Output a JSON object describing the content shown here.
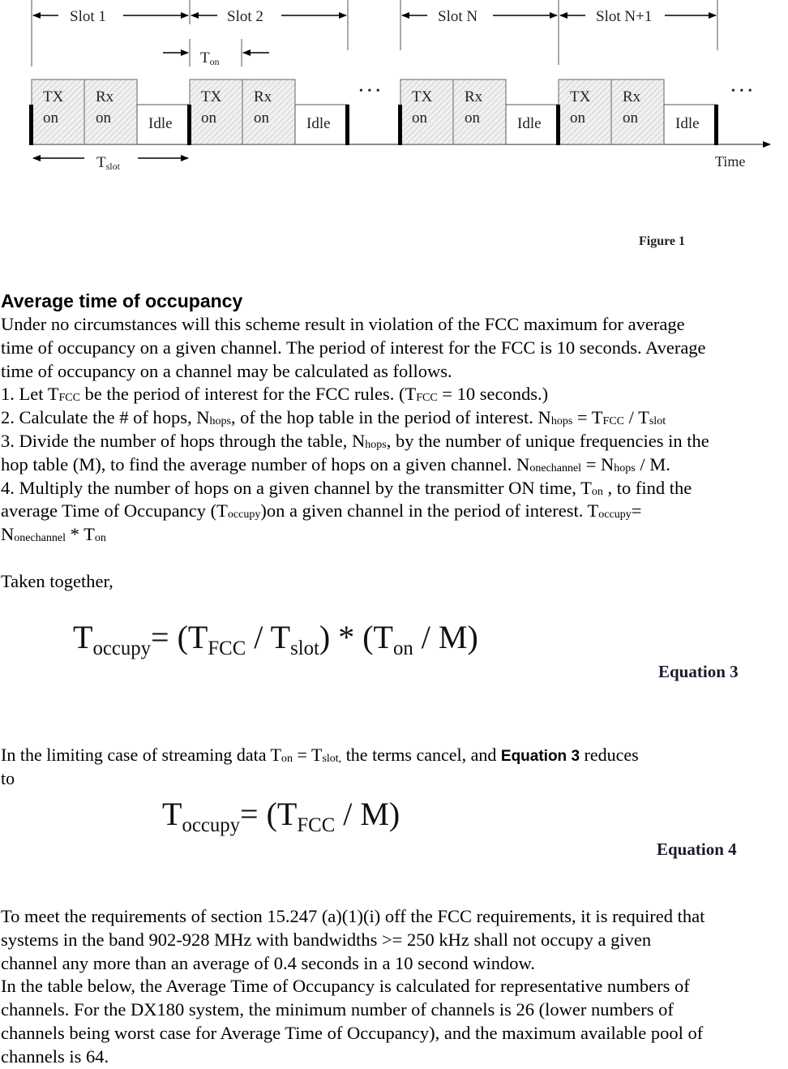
{
  "figure": {
    "slot_labels": [
      "Slot 1",
      "Slot 2",
      "Slot N",
      "Slot N+1"
    ],
    "ton_label": "T",
    "ton_sub": "on",
    "tslot_label": "T",
    "tslot_sub": "slot",
    "block_tx": [
      "TX",
      "on"
    ],
    "block_rx": [
      "Rx",
      "on"
    ],
    "block_idle": "Idle",
    "ellipsis": "• • •",
    "time_label": "Time",
    "caption": "Figure 1",
    "colors": {
      "hatch": "#d9d9d9",
      "outline": "#555555",
      "bar": "#000000"
    }
  },
  "section": {
    "heading": "Average time of occupancy",
    "intro_lines": [
      "Under no circumstances will this scheme result in violation of the FCC maximum for average",
      "time of occupancy on a given channel. The period of interest for the FCC is 10 seconds. Average",
      "time of occupancy on a channel may be calculated as follows."
    ],
    "steps": {
      "s1": {
        "a": "1. Let T",
        "sub1": "FCC",
        "b": " be the period of interest for the FCC rules. (T",
        "sub2": "FCC",
        "c": " = 10 seconds.)"
      },
      "s2": {
        "a": "2. Calculate the # of hops, N",
        "sub1": "hops",
        "b": ", of the hop table in the period of interest. N",
        "sub2": "hops",
        "c": " = T",
        "sub3": "FCC",
        "d": " / T",
        "sub4": "slot"
      },
      "s3": {
        "a": "3. Divide the number of hops through the table, N",
        "sub1": "hops",
        "b": ", by the number of unique frequencies in the",
        "c": "hop table (M), to find the average number of hops on a given channel. N",
        "sub2": "onechannel",
        "d": " = N",
        "sub3": "hops",
        "e": " / M."
      },
      "s4": {
        "a": "4. Multiply the number of hops on a given channel by the transmitter ON time, T",
        "sub1": "on",
        "b": " , to find the",
        "c": "average Time of Occupancy (T",
        "sub2": "occupy",
        "d": ")on a given channel in the period of interest. T",
        "sub3": "occupy",
        "e": "=",
        "f": "N",
        "sub4": "onechannel",
        "g": " * T",
        "sub5": "on"
      }
    },
    "taken_together": "Taken together,"
  },
  "equation3": {
    "lhs": "T",
    "lhs_sub": "occupy",
    "p1": "= (T",
    "p1_sub": "FCC",
    "p2": " / T",
    "p2_sub": "slot",
    "p3": ") * (T",
    "p3_sub": "on",
    "p4": " / M)",
    "label": "Equation 3"
  },
  "limiting": {
    "a": "In the limiting case of streaming data T",
    "sub1": "on",
    "b": " = T",
    "sub2": "slot,",
    "c": " the terms cancel, and ",
    "bold": "Equation 3",
    "d": " reduces",
    "line2": "to"
  },
  "equation4": {
    "lhs": "T",
    "lhs_sub": "occupy",
    "p1": "= (T",
    "p1_sub": "FCC",
    "p2": " / M)",
    "label": "Equation 4"
  },
  "requirements": {
    "lines": [
      "To meet the requirements of section 15.247 (a)(1)(i) off the FCC requirements, it is required that",
      "systems in the band 902-928 MHz with bandwidths >= 250 kHz shall not occupy a given",
      "channel any more than an average of 0.4 seconds in a 10 second window.",
      "In the table below, the Average Time of Occupancy is calculated for representative numbers of",
      "channels. For the DX180 system, the minimum number of channels is 26 (lower numbers of",
      "channels being worst case for Average Time of Occupancy), and the maximum available pool of",
      "channels is 64."
    ]
  }
}
